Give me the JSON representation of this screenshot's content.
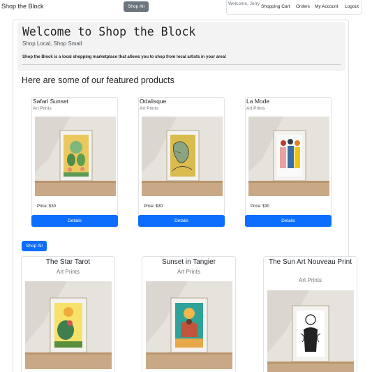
{
  "nav": {
    "brand": "Shop the Block",
    "shop_all": "Shop All",
    "welcome": "Welcome, Jerry",
    "links": [
      "Shopping Cart",
      "Orders",
      "My Account",
      "Logout"
    ]
  },
  "hero": {
    "title": "Welcome to Shop the Block",
    "subtitle": "Shop Local, Shop Small",
    "description": "Shop the Block is a local shopping marketplace that allows you to shop from local artists in your area!"
  },
  "featured": {
    "heading": "Here are some of our featured products",
    "products": [
      {
        "title": "Safari Sunset",
        "category": "Art Prints",
        "price": "Price: $30",
        "button": "Details"
      },
      {
        "title": "Odalisque",
        "category": "Art Prints",
        "price": "Price: $30",
        "button": "Details"
      },
      {
        "title": "La Mode",
        "category": "Art Prints",
        "price": "Price: $30",
        "button": "Details"
      }
    ]
  },
  "shop_all_button": "Shop All",
  "all_products": [
    {
      "title": "The Star Tarot",
      "category": "Art Prints"
    },
    {
      "title": "Sunset in Tangier",
      "category": "Art Prints"
    },
    {
      "title": "The Sun Art Nouveau Print",
      "category": "Art Prints"
    }
  ],
  "colors": {
    "primary": "#0d6efd",
    "secondary": "#6c757d"
  }
}
